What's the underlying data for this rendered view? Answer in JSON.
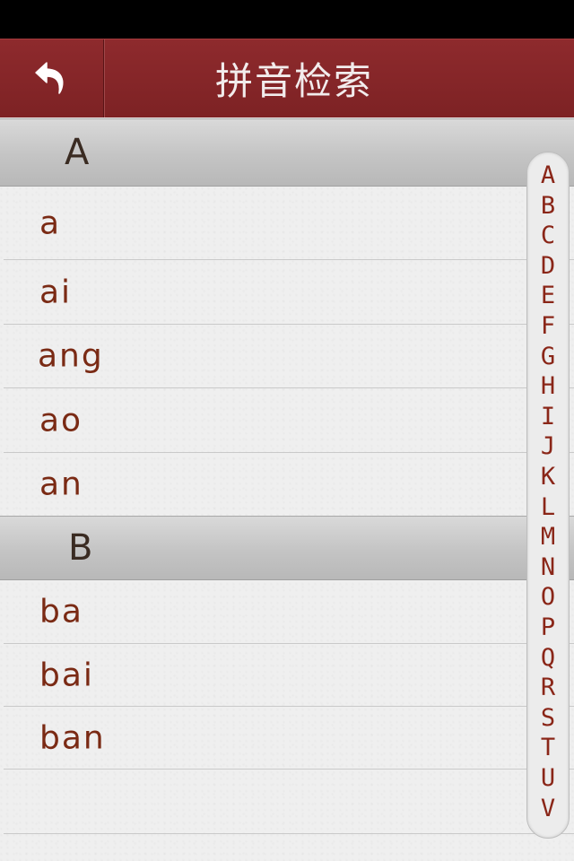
{
  "nav": {
    "title": "拼音检索",
    "back_icon": "back-arrow-icon"
  },
  "sections": [
    {
      "letter": "A",
      "items": [
        "a",
        "ai",
        "ang",
        "ao",
        "an"
      ]
    },
    {
      "letter": "B",
      "items": [
        "ba",
        "bai",
        "ban",
        ""
      ]
    }
  ],
  "index_letters": [
    "A",
    "B",
    "C",
    "D",
    "E",
    "F",
    "G",
    "H",
    "I",
    "J",
    "K",
    "L",
    "M",
    "N",
    "O",
    "P",
    "Q",
    "R",
    "S",
    "T",
    "U",
    "V"
  ],
  "colors": {
    "nav_bar": "#8a2729",
    "item_text": "#7a2a14",
    "index_text": "#8a2618"
  }
}
